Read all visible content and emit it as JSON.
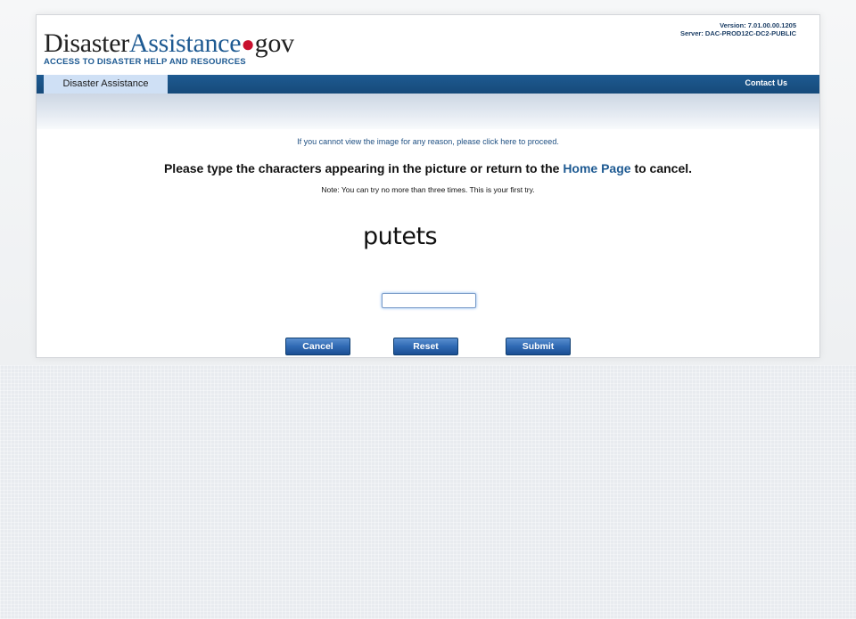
{
  "header": {
    "logo": {
      "part1": "Disaster",
      "part2": "Assistance",
      "dot": "●",
      "part3": "gov",
      "tagline": "ACCESS TO DISASTER HELP AND RESOURCES"
    },
    "version": "Version: 7.01.00.00.1205",
    "server": "Server: DAC-PROD12C-DC2-PUBLIC"
  },
  "nav": {
    "tab_label": "Disaster Assistance",
    "contact_label": "Contact Us"
  },
  "captcha_page": {
    "proceed_text": "If you cannot view the image for any reason, please click here to proceed.",
    "instruction_before": "Please type the characters appearing in the picture or return to the ",
    "home_link": "Home Page",
    "instruction_after": " to cancel.",
    "note": "Note: You can try no more than three times. This is your first try.",
    "captcha_text": "putets",
    "input_value": ""
  },
  "buttons": {
    "cancel": "Cancel",
    "reset": "Reset",
    "submit": "Submit"
  },
  "colors": {
    "brand_blue": "#1e5a92",
    "navbar": "#164a7a",
    "tab_active": "#cfe0f5",
    "logo_dot": "#c8102e"
  }
}
